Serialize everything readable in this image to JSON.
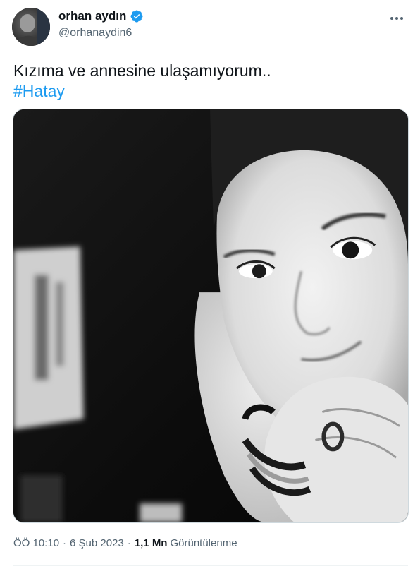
{
  "author": {
    "display_name": "orhan aydın",
    "handle": "@orhanaydin6",
    "verified": true
  },
  "icons": {
    "verified": "verified-badge-icon",
    "more": "more-options-icon"
  },
  "tweet": {
    "text_line1": "Kızıma ve annesine ulaşamıyorum..",
    "hashtag": "#Hatay"
  },
  "meta": {
    "time": "ÖÖ 10:10",
    "separator": "·",
    "date": "6 Şub 2023",
    "views_count": "1,1 Mn",
    "views_label": "Görüntülenme"
  },
  "colors": {
    "accent": "#1d9bf0",
    "text_primary": "#0f1419",
    "text_secondary": "#536471"
  }
}
